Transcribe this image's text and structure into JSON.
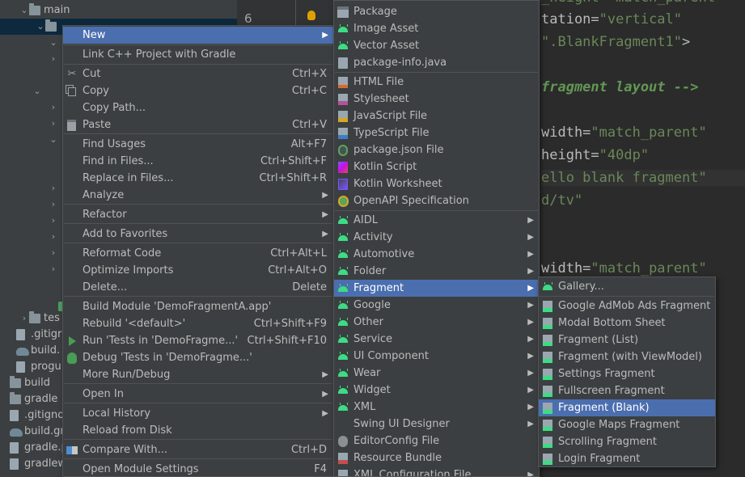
{
  "tree": {
    "rows": [
      {
        "label": "main",
        "chev": "⌄",
        "icon": "folder-icon"
      },
      {
        "label": "",
        "chev": "⌄",
        "icon": "folder-icon"
      },
      {
        "label": "",
        "chev": "⌄",
        "icon": ""
      },
      {
        "label": "",
        "chev": "›",
        "icon": ""
      },
      {
        "label": "",
        "chev": "",
        "icon": ""
      },
      {
        "label": "",
        "chev": "⌄",
        "icon": ""
      },
      {
        "label": "",
        "chev": "›",
        "icon": ""
      },
      {
        "label": "",
        "chev": "›",
        "icon": ""
      },
      {
        "label": "",
        "chev": "⌄",
        "icon": ""
      },
      {
        "label": "",
        "chev": "",
        "icon": ""
      },
      {
        "label": "",
        "chev": "",
        "icon": ""
      },
      {
        "label": "",
        "chev": "›",
        "icon": ""
      },
      {
        "label": "",
        "chev": "›",
        "icon": ""
      },
      {
        "label": "",
        "chev": "›",
        "icon": ""
      },
      {
        "label": "",
        "chev": "›",
        "icon": ""
      },
      {
        "label": "",
        "chev": "›",
        "icon": ""
      },
      {
        "label": "",
        "chev": "›",
        "icon": ""
      },
      {
        "label": "",
        "chev": "",
        "icon": ""
      },
      {
        "label": "",
        "chev": "",
        "icon": "hf-icon"
      },
      {
        "label": "tes",
        "chev": "›",
        "icon": "folder-icon"
      },
      {
        "label": ".gitigr",
        "chev": "",
        "icon": "file-icon"
      },
      {
        "label": "build.",
        "chev": "",
        "icon": "gradle-icon"
      },
      {
        "label": "progu",
        "chev": "",
        "icon": "file-icon"
      },
      {
        "label": "build",
        "chev": "",
        "icon": "folder-icon"
      },
      {
        "label": "gradle",
        "chev": "",
        "icon": "folder-icon"
      },
      {
        "label": ".gitignor",
        "chev": "",
        "icon": "file-icon"
      },
      {
        "label": "build.gra",
        "chev": "",
        "icon": "gradle-icon"
      },
      {
        "label": "gradle.p",
        "chev": "",
        "icon": "file-icon"
      },
      {
        "label": "gradlew",
        "chev": "",
        "icon": "file-icon"
      }
    ]
  },
  "gutter": {
    "line_number": "6"
  },
  "editor": {
    "lines": [
      {
        "parts": [
          {
            "t": "_height=\"match_parent",
            "c": "str"
          }
        ]
      },
      {
        "parts": [
          {
            "t": "tation=",
            "c": "attr"
          },
          {
            "t": "\"vertical\"",
            "c": "str"
          }
        ]
      },
      {
        "parts": [
          {
            "t": "\".BlankFragment1\"",
            "c": "str"
          },
          {
            "t": ">",
            "c": "attr"
          }
        ]
      },
      {
        "parts": [
          {
            "t": "fragment layout -->",
            "c": "cmt"
          }
        ]
      },
      {
        "parts": [
          {
            "t": "width=",
            "c": "attr"
          },
          {
            "t": "\"match_parent\"",
            "c": "str"
          }
        ]
      },
      {
        "parts": [
          {
            "t": "height=",
            "c": "attr"
          },
          {
            "t": "\"40dp\"",
            "c": "str"
          }
        ]
      },
      {
        "parts": [
          {
            "t": "ello blank fragment\"",
            "c": "str"
          }
        ]
      },
      {
        "parts": [
          {
            "t": "d/tv\"",
            "c": "str"
          }
        ]
      },
      {
        "parts": [
          {
            "t": "width=",
            "c": "attr"
          },
          {
            "t": "\"match_parent\"",
            "c": "str"
          }
        ]
      }
    ]
  },
  "context_menu": {
    "items": [
      {
        "label": "New",
        "shortcut": "",
        "submenu": true,
        "selected": true,
        "icon": ""
      },
      {
        "sep": true
      },
      {
        "label": "Link C++ Project with Gradle",
        "shortcut": "",
        "submenu": false,
        "icon": ""
      },
      {
        "sep": true
      },
      {
        "label": "Cut",
        "shortcut": "Ctrl+X",
        "submenu": false,
        "icon": "cut-icon"
      },
      {
        "label": "Copy",
        "shortcut": "Ctrl+C",
        "submenu": false,
        "icon": "copy-icon"
      },
      {
        "label": "Copy Path...",
        "shortcut": "",
        "submenu": false,
        "icon": ""
      },
      {
        "label": "Paste",
        "shortcut": "Ctrl+V",
        "submenu": false,
        "icon": "paste-icon"
      },
      {
        "sep": true
      },
      {
        "label": "Find Usages",
        "shortcut": "Alt+F7",
        "submenu": false,
        "icon": ""
      },
      {
        "label": "Find in Files...",
        "shortcut": "Ctrl+Shift+F",
        "submenu": false,
        "icon": ""
      },
      {
        "label": "Replace in Files...",
        "shortcut": "Ctrl+Shift+R",
        "submenu": false,
        "icon": ""
      },
      {
        "label": "Analyze",
        "shortcut": "",
        "submenu": true,
        "icon": ""
      },
      {
        "sep": true
      },
      {
        "label": "Refactor",
        "shortcut": "",
        "submenu": true,
        "icon": ""
      },
      {
        "sep": true
      },
      {
        "label": "Add to Favorites",
        "shortcut": "",
        "submenu": true,
        "icon": ""
      },
      {
        "sep": true
      },
      {
        "label": "Reformat Code",
        "shortcut": "Ctrl+Alt+L",
        "submenu": false,
        "icon": ""
      },
      {
        "label": "Optimize Imports",
        "shortcut": "Ctrl+Alt+O",
        "submenu": false,
        "icon": ""
      },
      {
        "label": "Delete...",
        "shortcut": "Delete",
        "submenu": false,
        "icon": ""
      },
      {
        "sep": true
      },
      {
        "label": "Build Module 'DemoFragmentA.app'",
        "shortcut": "",
        "submenu": false,
        "icon": ""
      },
      {
        "label": "Rebuild '<default>'",
        "shortcut": "Ctrl+Shift+F9",
        "submenu": false,
        "icon": ""
      },
      {
        "label": "Run 'Tests in 'DemoFragme...'",
        "shortcut": "Ctrl+Shift+F10",
        "submenu": false,
        "icon": "run-icon"
      },
      {
        "label": "Debug 'Tests in 'DemoFragme...'",
        "shortcut": "",
        "submenu": false,
        "icon": "debug-icon"
      },
      {
        "label": "More Run/Debug",
        "shortcut": "",
        "submenu": true,
        "icon": ""
      },
      {
        "sep": true
      },
      {
        "label": "Open In",
        "shortcut": "",
        "submenu": true,
        "icon": ""
      },
      {
        "sep": true
      },
      {
        "label": "Local History",
        "shortcut": "",
        "submenu": true,
        "icon": ""
      },
      {
        "label": "Reload from Disk",
        "shortcut": "",
        "submenu": false,
        "icon": ""
      },
      {
        "sep": true
      },
      {
        "label": "Compare With...",
        "shortcut": "Ctrl+D",
        "submenu": false,
        "icon": "compare-icon"
      },
      {
        "sep": true
      },
      {
        "label": "Open Module Settings",
        "shortcut": "F4",
        "submenu": false,
        "icon": ""
      }
    ]
  },
  "new_submenu": {
    "items": [
      {
        "label": "Package",
        "icon": "package-icon",
        "submenu": false
      },
      {
        "label": "Image Asset",
        "icon": "android-icon",
        "submenu": false
      },
      {
        "label": "Vector Asset",
        "icon": "android-icon",
        "submenu": false
      },
      {
        "label": "package-info.java",
        "icon": "file-icon",
        "submenu": false
      },
      {
        "sep": true
      },
      {
        "label": "HTML File",
        "icon": "html-icon",
        "submenu": false
      },
      {
        "label": "Stylesheet",
        "icon": "css-icon",
        "submenu": false
      },
      {
        "label": "JavaScript File",
        "icon": "js-icon",
        "submenu": false
      },
      {
        "label": "TypeScript File",
        "icon": "ts-icon",
        "submenu": false
      },
      {
        "label": "package.json File",
        "icon": "json-icon",
        "submenu": false
      },
      {
        "label": "Kotlin Script",
        "icon": "kotlin-icon",
        "submenu": false
      },
      {
        "label": "Kotlin Worksheet",
        "icon": "kotlin-worksheet-icon",
        "submenu": false
      },
      {
        "label": "OpenAPI Specification",
        "icon": "openapi-icon",
        "submenu": false
      },
      {
        "sep": true
      },
      {
        "label": "AIDL",
        "icon": "android-icon",
        "submenu": true
      },
      {
        "label": "Activity",
        "icon": "android-icon",
        "submenu": true
      },
      {
        "label": "Automotive",
        "icon": "android-icon",
        "submenu": true
      },
      {
        "label": "Folder",
        "icon": "android-icon",
        "submenu": true
      },
      {
        "label": "Fragment",
        "icon": "android-icon",
        "submenu": true,
        "selected": true
      },
      {
        "label": "Google",
        "icon": "android-icon",
        "submenu": true
      },
      {
        "label": "Other",
        "icon": "android-icon",
        "submenu": true
      },
      {
        "label": "Service",
        "icon": "android-icon",
        "submenu": true
      },
      {
        "label": "UI Component",
        "icon": "android-icon",
        "submenu": true
      },
      {
        "label": "Wear",
        "icon": "android-icon",
        "submenu": true
      },
      {
        "label": "Widget",
        "icon": "android-icon",
        "submenu": true
      },
      {
        "label": "XML",
        "icon": "android-icon",
        "submenu": true
      },
      {
        "label": "Swing UI Designer",
        "icon": "",
        "submenu": true
      },
      {
        "label": "EditorConfig File",
        "icon": "editorconfig-icon",
        "submenu": false
      },
      {
        "label": "Resource Bundle",
        "icon": "resource-bundle-icon",
        "submenu": false
      },
      {
        "label": "XML Configuration File",
        "icon": "xml-config-icon",
        "submenu": true
      }
    ]
  },
  "fragment_submenu": {
    "items": [
      {
        "label": "Gallery...",
        "icon": "android-icon"
      },
      {
        "sep": true
      },
      {
        "label": "Google AdMob Ads Fragment",
        "icon": "fragment-icon"
      },
      {
        "label": "Modal Bottom Sheet",
        "icon": "fragment-icon"
      },
      {
        "label": "Fragment (List)",
        "icon": "fragment-icon"
      },
      {
        "label": "Fragment (with ViewModel)",
        "icon": "fragment-icon"
      },
      {
        "label": "Settings Fragment",
        "icon": "fragment-icon"
      },
      {
        "label": "Fullscreen Fragment",
        "icon": "fragment-icon"
      },
      {
        "label": "Fragment (Blank)",
        "icon": "fragment-icon",
        "selected": true
      },
      {
        "label": "Google Maps Fragment",
        "icon": "fragment-icon"
      },
      {
        "label": "Scrolling Fragment",
        "icon": "fragment-icon"
      },
      {
        "label": "Login Fragment",
        "icon": "fragment-icon"
      }
    ]
  },
  "colors": {
    "selection": "#4b6eaf",
    "menu_bg": "#3c3f41",
    "editor_bg": "#2b2b2b",
    "string": "#6a8759",
    "comment": "#629755"
  }
}
